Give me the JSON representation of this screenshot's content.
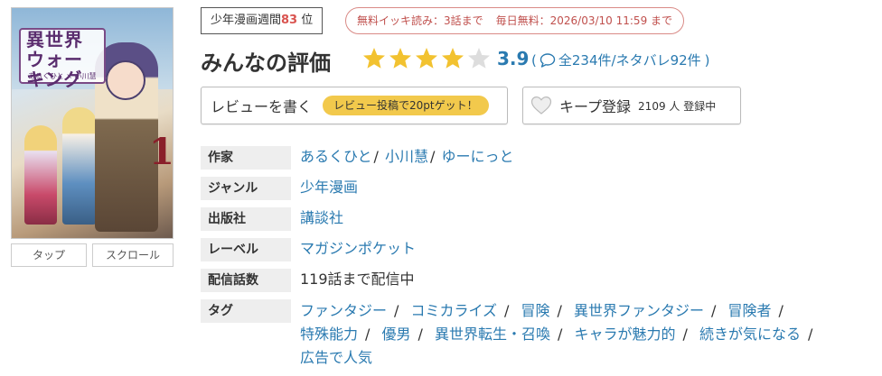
{
  "cover": {
    "title": "異世界ウォーキング",
    "authors": "あるくひと × 小川慧",
    "volume": "1"
  },
  "cover_buttons": {
    "tap": "タップ",
    "scroll": "スクロール"
  },
  "ranking": {
    "label": "少年漫画週間",
    "rank": "83",
    "suffix": "位"
  },
  "free_read": {
    "bulk": "無料イッキ読み：3話まで",
    "daily": "毎日無料：2026/03/10 11:59 まで"
  },
  "rating": {
    "title": "みんなの評価",
    "stars_value": 3.9,
    "score": "3.9",
    "open_paren": "(",
    "total_reviews": "全234件",
    "slash": "/",
    "spoiler_reviews": "ネタバレ92件",
    "close_paren": ")"
  },
  "actions": {
    "write_review": "レビューを書く",
    "review_promo": "レビュー投稿で20ptゲット！",
    "keep": "キープ登録",
    "keep_count": "2109 人 登録中"
  },
  "info": {
    "author": {
      "label": "作家",
      "values": [
        "あるくひと",
        "小川慧",
        "ゆーにっと"
      ]
    },
    "genre": {
      "label": "ジャンル",
      "value": "少年漫画"
    },
    "publisher": {
      "label": "出版社",
      "value": "講談社"
    },
    "label_row": {
      "label": "レーベル",
      "value": "マガジンポケット"
    },
    "episodes": {
      "label": "配信話数",
      "value": "119話まで配信中"
    },
    "tags": {
      "label": "タグ",
      "values": [
        "ファンタジー",
        "コミカライズ",
        "冒険",
        "異世界ファンタジー",
        "冒険者",
        "特殊能力",
        "優男",
        "異世界転生・召喚",
        "キャラが魅力的",
        "続きが気になる",
        "広告で人気"
      ]
    }
  },
  "colors": {
    "link": "#2a7ab0",
    "star_filled": "#f2c230",
    "star_empty": "#dddddd",
    "rank_number": "#d9534f",
    "free_border": "#d98a86",
    "promo_bg": "#f2c94c"
  }
}
